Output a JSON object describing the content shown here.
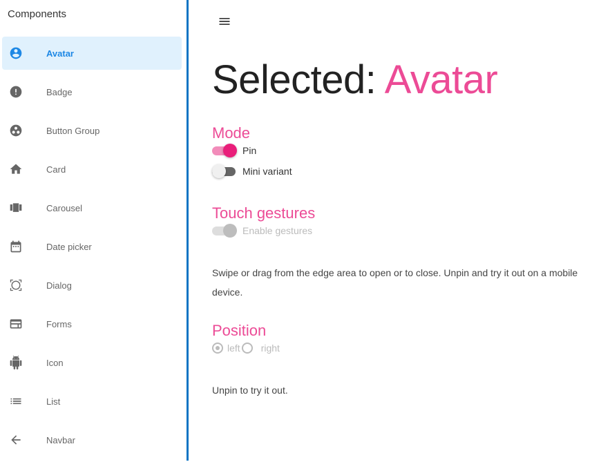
{
  "sidebar": {
    "title": "Components",
    "items": [
      {
        "label": "Avatar",
        "icon": "account-circle-icon",
        "active": true
      },
      {
        "label": "Badge",
        "icon": "error-icon",
        "active": false
      },
      {
        "label": "Button Group",
        "icon": "group-work-icon",
        "active": false
      },
      {
        "label": "Card",
        "icon": "home-icon",
        "active": false
      },
      {
        "label": "Carousel",
        "icon": "view-carousel-icon",
        "active": false
      },
      {
        "label": "Date picker",
        "icon": "calendar-icon",
        "active": false
      },
      {
        "label": "Dialog",
        "icon": "dialog-frame-icon",
        "active": false
      },
      {
        "label": "Forms",
        "icon": "web-form-icon",
        "active": false
      },
      {
        "label": "Icon",
        "icon": "android-icon",
        "active": false
      },
      {
        "label": "List",
        "icon": "list-icon",
        "active": false
      },
      {
        "label": "Navbar",
        "icon": "arrow-back-icon",
        "active": false
      }
    ]
  },
  "colors": {
    "accent": "#ec4b96",
    "primary": "#1e88e5",
    "divider": "#0a74c4",
    "active_bg": "#e0f1fd"
  },
  "main": {
    "headline_prefix": "Selected:",
    "headline_value": "Avatar",
    "mode": {
      "title": "Mode",
      "pin_label": "Pin",
      "pin_on": true,
      "mini_label": "Mini variant",
      "mini_on": false
    },
    "touch": {
      "title": "Touch gestures",
      "gestures_label": "Enable gestures",
      "gestures_on": true,
      "disabled": true,
      "description": "Swipe or drag from the edge area to open or to close. Unpin and try it out on a mobile device."
    },
    "position": {
      "title": "Position",
      "options": [
        "left",
        "right"
      ],
      "selected": "left",
      "disabled": true,
      "note": "Unpin to try it out."
    }
  }
}
